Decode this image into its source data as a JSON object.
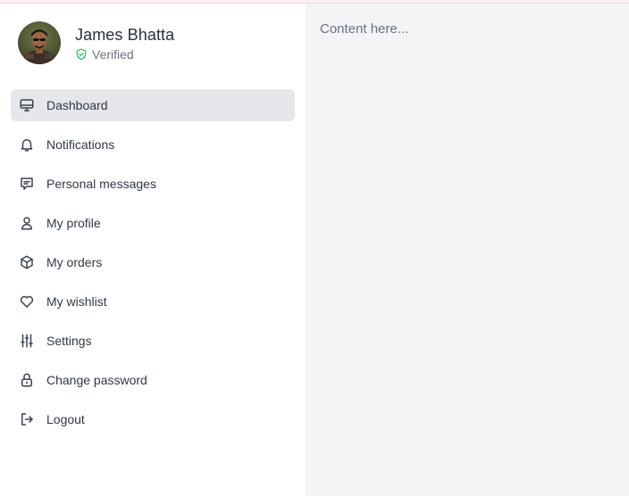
{
  "profile": {
    "name": "James Bhatta",
    "status": "Verified"
  },
  "colors": {
    "verified_green": "#22c55e",
    "active_bg": "#e6e7ea",
    "content_bg": "#f3f4f6"
  },
  "nav": {
    "items": [
      {
        "label": "Dashboard",
        "icon": "monitor-icon",
        "active": true
      },
      {
        "label": "Notifications",
        "icon": "bell-icon"
      },
      {
        "label": "Personal messages",
        "icon": "message-icon"
      },
      {
        "label": "My profile",
        "icon": "user-icon"
      },
      {
        "label": "My orders",
        "icon": "box-icon"
      },
      {
        "label": "My wishlist",
        "icon": "heart-icon"
      },
      {
        "label": "Settings",
        "icon": "sliders-icon"
      },
      {
        "label": "Change password",
        "icon": "lock-icon"
      },
      {
        "label": "Logout",
        "icon": "logout-icon"
      }
    ]
  },
  "main": {
    "placeholder_text": "Content here..."
  }
}
